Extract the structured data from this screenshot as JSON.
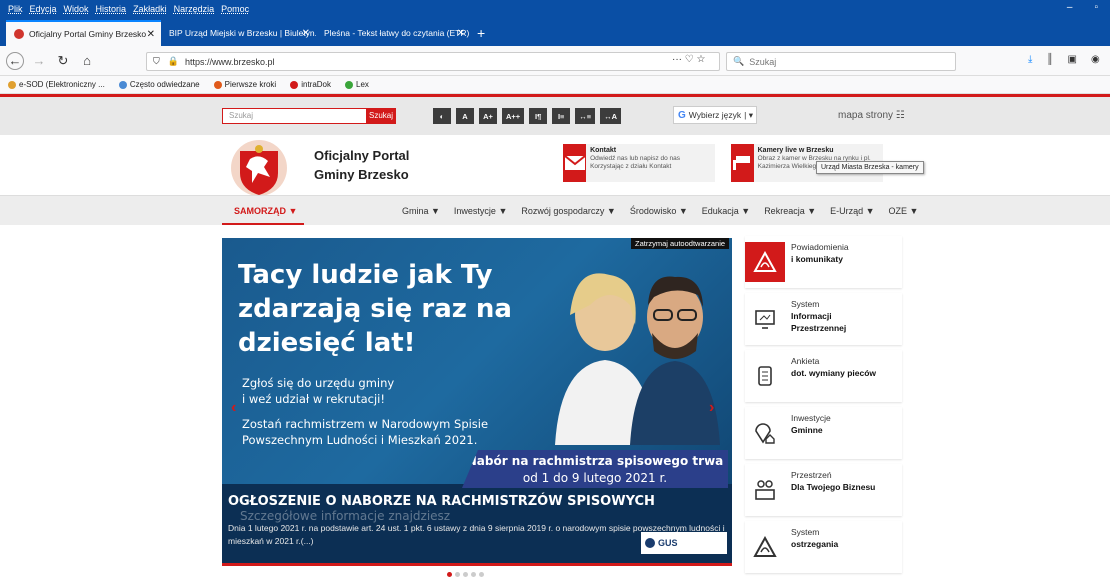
{
  "browser": {
    "menu": [
      "Plik",
      "Edycja",
      "Widok",
      "Historia",
      "Zakładki",
      "Narzędzia",
      "Pomoc"
    ],
    "window_controls": [
      "–",
      "▫"
    ],
    "tabs": [
      {
        "title": "Oficjalny Portal Gminy Brzesko",
        "active": true
      },
      {
        "title": "BIP Urząd Miejski w Brzesku | Biuletyn...",
        "active": false
      },
      {
        "title": "Pleśna - Tekst łatwy do czytania (ETR)",
        "active": false
      }
    ],
    "new_tab": "+",
    "url": "https://www.brzesko.pl",
    "url_actions": "··· ♡ ☆",
    "search_placeholder": "Szukaj",
    "bookmarks": [
      {
        "label": "e-SOD (Elektroniczny ...",
        "color": "#e0a030"
      },
      {
        "label": "Często odwiedzane",
        "color": "#4a8ad4"
      },
      {
        "label": "Pierwsze kroki",
        "color": "#e05a1a"
      },
      {
        "label": "intraDok",
        "color": "#d21a1a"
      },
      {
        "label": "Lex",
        "color": "#3aa53a"
      }
    ]
  },
  "site": {
    "accent": "#d21a1a",
    "search_placeholder": "Szukaj",
    "search_button": "Szukaj",
    "accessibility": [
      "◐",
      "A",
      "A+",
      "A++",
      "I¶",
      "I≡",
      "↔≡",
      "↔A"
    ],
    "language": {
      "label": "Wybierz język",
      "google": "G"
    },
    "sitemap": "mapa strony",
    "portal_title_1": "Oficjalny Portal",
    "portal_title_2": "Gminy Brzesko",
    "contact": {
      "title": "Kontakt",
      "text": "Odwiedź nas lub napisz do nas Korzystając z działu Kontakt"
    },
    "cams": {
      "title": "Kamery live w Brzesku",
      "text": "Obraz z kamer w Brzesku na rynku i pl. Kazimierza Wielkiego"
    },
    "tooltip": "Urząd Miasta Brzeska - kamery",
    "nav_active": "SAMORZĄD ▼",
    "nav": [
      "Gmina ▼",
      "Inwestycje ▼",
      "Rozwój gospodarczy ▼",
      "Środowisko ▼",
      "Edukacja ▼",
      "Rekreacja ▼",
      "E-Urząd ▼",
      "OZE ▼"
    ],
    "slider": {
      "stop": "Zatrzymaj autoodtwarzanie",
      "headline": [
        "Tacy ludzie jak Ty",
        "zdarzają się raz na",
        "dziesięć lat!"
      ],
      "sub1": [
        "Zgłoś się do urzędu gminy",
        "i weź udział w rekrutacji!"
      ],
      "sub2": [
        "Zostań rachmistrzem w Narodowym Spisie",
        "Powszechnym Ludności i Mieszkań 2021."
      ],
      "nabor": [
        "Nabór na rachmistrza spisowego trwa",
        "od 1 do 9 lutego 2021 r."
      ],
      "ogloszenie": "OGŁOSZENIE O NABORZE NA RACHMISTRZÓW SPISOWYCH",
      "szczegoly": "Szczegółowe informacje znajdziesz",
      "desc": "Dnia 1 lutego 2021 r. na podstawie art. 24 ust. 1 pkt. 6 ustawy z dnia 9 sierpnia 2019 r. o narodowym spisie powszechnym ludności i mieszkań w 2021 r.(...)",
      "gus": "GUS",
      "prev": "‹",
      "next": "›"
    },
    "side": [
      {
        "line1": "Powiadomienia",
        "line2": "i komunikaty",
        "icon": "warning-icon",
        "red": true
      },
      {
        "line1": "System",
        "line2": "Informacji Przestrzennej",
        "icon": "map-monitor-icon",
        "red": false
      },
      {
        "line1": "Ankieta",
        "line2": "dot. wymiany pieców",
        "icon": "scroll-icon",
        "red": false
      },
      {
        "line1": "Inwestycje",
        "line2": "Gminne",
        "icon": "house-location-icon",
        "red": false
      },
      {
        "line1": "Przestrzeń",
        "line2": "Dla Twojego Biznesu",
        "icon": "business-icon",
        "red": false
      },
      {
        "line1": "System",
        "line2": "ostrzegania",
        "icon": "alert-triangle-icon",
        "red": false
      }
    ]
  }
}
